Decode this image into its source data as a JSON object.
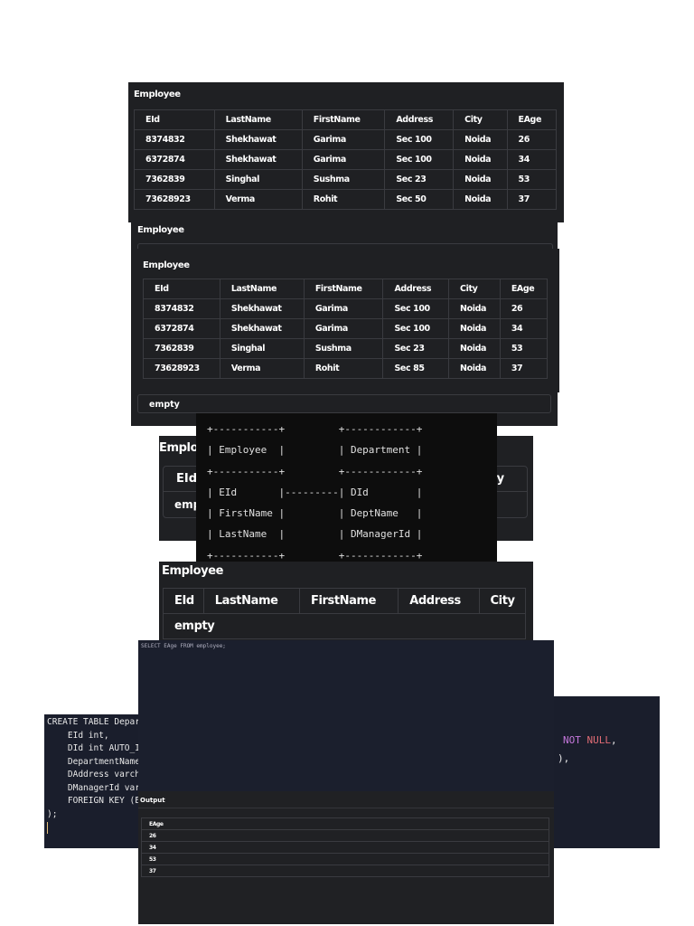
{
  "tables": {
    "title": "Employee",
    "headers": [
      "EId",
      "LastName",
      "FirstName",
      "Address",
      "City",
      "EAge"
    ],
    "panel1_rows": [
      [
        "8374832",
        "Shekhawat",
        "Garima",
        "Sec 100",
        "Noida",
        "26"
      ],
      [
        "6372874",
        "Shekhawat",
        "Garima",
        "Sec 100",
        "Noida",
        "34"
      ],
      [
        "7362839",
        "Singhal",
        "Sushma",
        "Sec 23",
        "Noida",
        "53"
      ],
      [
        "73628923",
        "Verma",
        "Rohit",
        "Sec 50",
        "Noida",
        "37"
      ]
    ],
    "panel3_rows": [
      [
        "8374832",
        "Shekhawat",
        "Garima",
        "Sec 100",
        "Noida",
        "26"
      ],
      [
        "6372874",
        "Shekhawat",
        "Garima",
        "Sec 100",
        "Noida",
        "34"
      ],
      [
        "7362839",
        "Singhal",
        "Sushma",
        "Sec 23",
        "Noida",
        "53"
      ],
      [
        "73628923",
        "Verma",
        "Rohit",
        "Sec 85",
        "Noida",
        "37"
      ]
    ],
    "empty": "empty",
    "partial_title": "Employ",
    "partial_empty": "emp",
    "partial_city": "ity"
  },
  "diagram": {
    "text": "+-----------+         +------------+\n| Employee  |         | Department |\n+-----------+         +------------+\n| EId       |---------| DId        |\n| FirstName |         | DeptName   |\n| LastName  |         | DManagerId |\n+-----------+         +------------+"
  },
  "editor": {
    "query": "SELECT EAge FROM employee;",
    "create_lines": [
      "CREATE TABLE Depar",
      "    EId int,",
      "    DId int AUTO_I",
      "    DepartmentName",
      "    DAddress varch",
      "    DManagerId varc",
      "    FOREIGN KEY (E",
      ");"
    ],
    "right_lines": [
      "NOT NULL,",
      "),"
    ]
  },
  "output": {
    "title": "Output",
    "header": "EAge",
    "values": [
      "26",
      "34",
      "53",
      "37"
    ]
  }
}
